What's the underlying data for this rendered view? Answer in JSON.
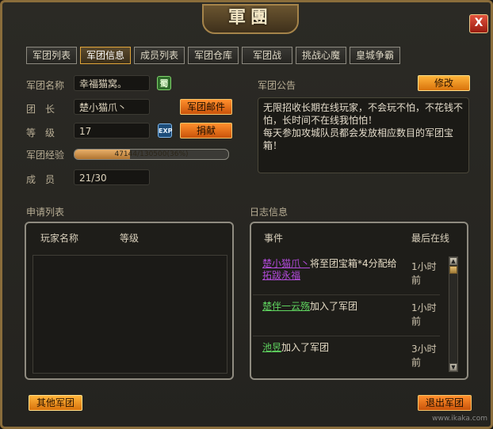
{
  "window": {
    "title": "軍團",
    "close_label": "X"
  },
  "tabs": [
    {
      "label": "军团列表"
    },
    {
      "label": "军团信息"
    },
    {
      "label": "成员列表"
    },
    {
      "label": "军团仓库"
    },
    {
      "label": "军团战"
    },
    {
      "label": "挑战心魔"
    },
    {
      "label": "皇城争霸"
    }
  ],
  "info": {
    "name_label": "军团名称",
    "name_value": "幸福猫窝。",
    "shu_badge": "蜀",
    "leader_label": "团　长",
    "leader_value": "楚小猫爪丶",
    "mail_button": "军团邮件",
    "level_label": "等　级",
    "level_value": "17",
    "exp_badge": "EXP",
    "donate_button": "捐献",
    "exp_label": "军团经验",
    "exp_text": "47144/130500(36%)",
    "exp_fraction": 0.36,
    "members_label": "成　员",
    "members_value": "21/30"
  },
  "notice": {
    "title": "军团公告",
    "edit_button": "修改",
    "text": "无限招收长期在线玩家，不会玩不怕，不花钱不怕，长时间不在线我怕怕！\n每天参加攻城队员都会发放相应数目的军团宝箱！"
  },
  "applications": {
    "title": "申请列表",
    "col_player": "玩家名称",
    "col_level": "等级"
  },
  "log": {
    "title": "日志信息",
    "col_event": "事件",
    "col_last_online": "最后在线",
    "entries": [
      {
        "name": "楚小猫爪丶",
        "action": "将至团宝箱*4分配给",
        "target": "拓跋永福",
        "time": "1小时前"
      },
      {
        "name": "楚伴一云殇",
        "action": "加入了军团",
        "time": "1小时前"
      },
      {
        "name": "池昱",
        "action": "加入了军团",
        "time": "3小时前"
      }
    ]
  },
  "footer": {
    "other_button": "其他军团",
    "quit_button": "退出军团",
    "watermark_url": "www.ikaka.com"
  },
  "colors": {
    "accent_orange": "#e07a1a",
    "log_name_purple": "#b04ad8",
    "log_name_green": "#5fd35f",
    "frame_gold": "#8a6d3b"
  }
}
